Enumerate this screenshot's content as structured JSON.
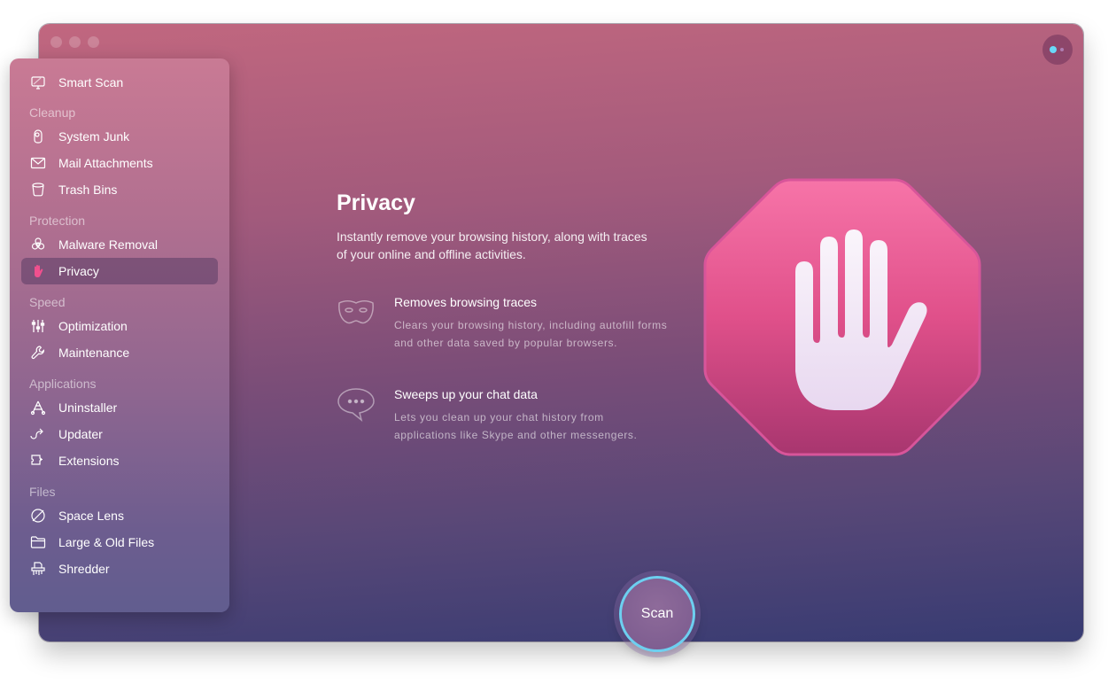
{
  "window": {
    "traffic_lights": [
      "close",
      "minimize",
      "zoom"
    ],
    "assistant_button": {
      "icon": "assistant-icon",
      "accent_color": "#6ad8f8"
    }
  },
  "sidebar": {
    "items": [
      {
        "label": "Smart Scan",
        "icon": "monitor-icon"
      },
      {
        "section": "Cleanup"
      },
      {
        "label": "System Junk",
        "icon": "junk-icon"
      },
      {
        "label": "Mail Attachments",
        "icon": "envelope-icon"
      },
      {
        "label": "Trash Bins",
        "icon": "trash-icon"
      },
      {
        "section": "Protection"
      },
      {
        "label": "Malware Removal",
        "icon": "biohazard-icon"
      },
      {
        "label": "Privacy",
        "icon": "hand-icon",
        "active": true
      },
      {
        "section": "Speed"
      },
      {
        "label": "Optimization",
        "icon": "sliders-icon"
      },
      {
        "label": "Maintenance",
        "icon": "wrench-icon"
      },
      {
        "section": "Applications"
      },
      {
        "label": "Uninstaller",
        "icon": "uninstaller-icon"
      },
      {
        "label": "Updater",
        "icon": "updater-icon"
      },
      {
        "label": "Extensions",
        "icon": "puzzle-icon"
      },
      {
        "section": "Files"
      },
      {
        "label": "Space Lens",
        "icon": "planet-icon"
      },
      {
        "label": "Large & Old Files",
        "icon": "folder-icon"
      },
      {
        "label": "Shredder",
        "icon": "shredder-icon"
      }
    ]
  },
  "main": {
    "title": "Privacy",
    "description": "Instantly remove your browsing history, along with traces of your online and offline activities.",
    "features": [
      {
        "icon": "mask-icon",
        "title": "Removes browsing traces",
        "description": "Clears your browsing history, including autofill forms and other data saved by popular browsers."
      },
      {
        "icon": "chat-bubble-icon",
        "title": "Sweeps up your chat data",
        "description": "Lets you clean up your chat history from applications like Skype and other messengers."
      }
    ],
    "hero_icon": "stop-hand-icon",
    "hero_color": "#e8508c"
  },
  "scan_button": {
    "label": "Scan",
    "ring_color": "#6dcff0"
  }
}
